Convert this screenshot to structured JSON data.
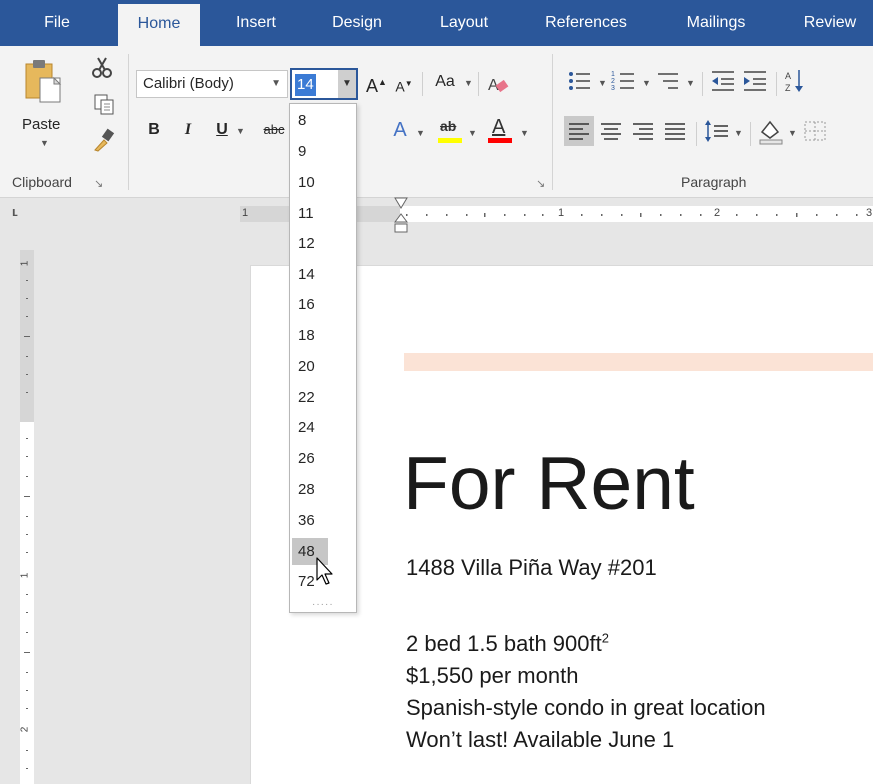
{
  "tabs": [
    {
      "label": "File",
      "active": false
    },
    {
      "label": "Home",
      "active": true
    },
    {
      "label": "Insert",
      "active": false
    },
    {
      "label": "Design",
      "active": false
    },
    {
      "label": "Layout",
      "active": false
    },
    {
      "label": "References",
      "active": false
    },
    {
      "label": "Mailings",
      "active": false
    },
    {
      "label": "Review",
      "active": false
    }
  ],
  "ribbon": {
    "paste_label": "Paste",
    "clipboard_label": "Clipboard",
    "paragraph_label": "Paragraph",
    "font_name": "Calibri (Body)",
    "font_size": "14",
    "bold": "B",
    "italic": "I",
    "underline": "U",
    "strike": "abc",
    "grow_font": "A",
    "shrink_font": "A",
    "change_case": "Aa",
    "text_effects": "A",
    "highlight": "ab",
    "font_color": "A"
  },
  "ruler": {
    "h_numbers": [
      "1",
      "1",
      "2",
      "3"
    ],
    "v_numbers": [
      "1",
      "1",
      "2"
    ]
  },
  "font_size_options": [
    "8",
    "9",
    "10",
    "11",
    "12",
    "14",
    "16",
    "18",
    "20",
    "22",
    "24",
    "26",
    "28",
    "36",
    "48",
    "72"
  ],
  "hovered_option": "48",
  "document": {
    "title": "For Rent",
    "address": "1488 Villa Piña Way #201",
    "details": "2 bed 1.5 bath 900ft",
    "details_sup": "2",
    "price": "$1,550 per month",
    "description": "Spanish-style condo in great location",
    "availability": "Won’t last! Available June 1"
  },
  "colors": {
    "tab_bar": "#2b579a",
    "ribbon": "#f3f3f3",
    "highlight_yellow": "#ffff00",
    "font_red": "#ff0000",
    "peach_bar": "#fbe3d6"
  }
}
